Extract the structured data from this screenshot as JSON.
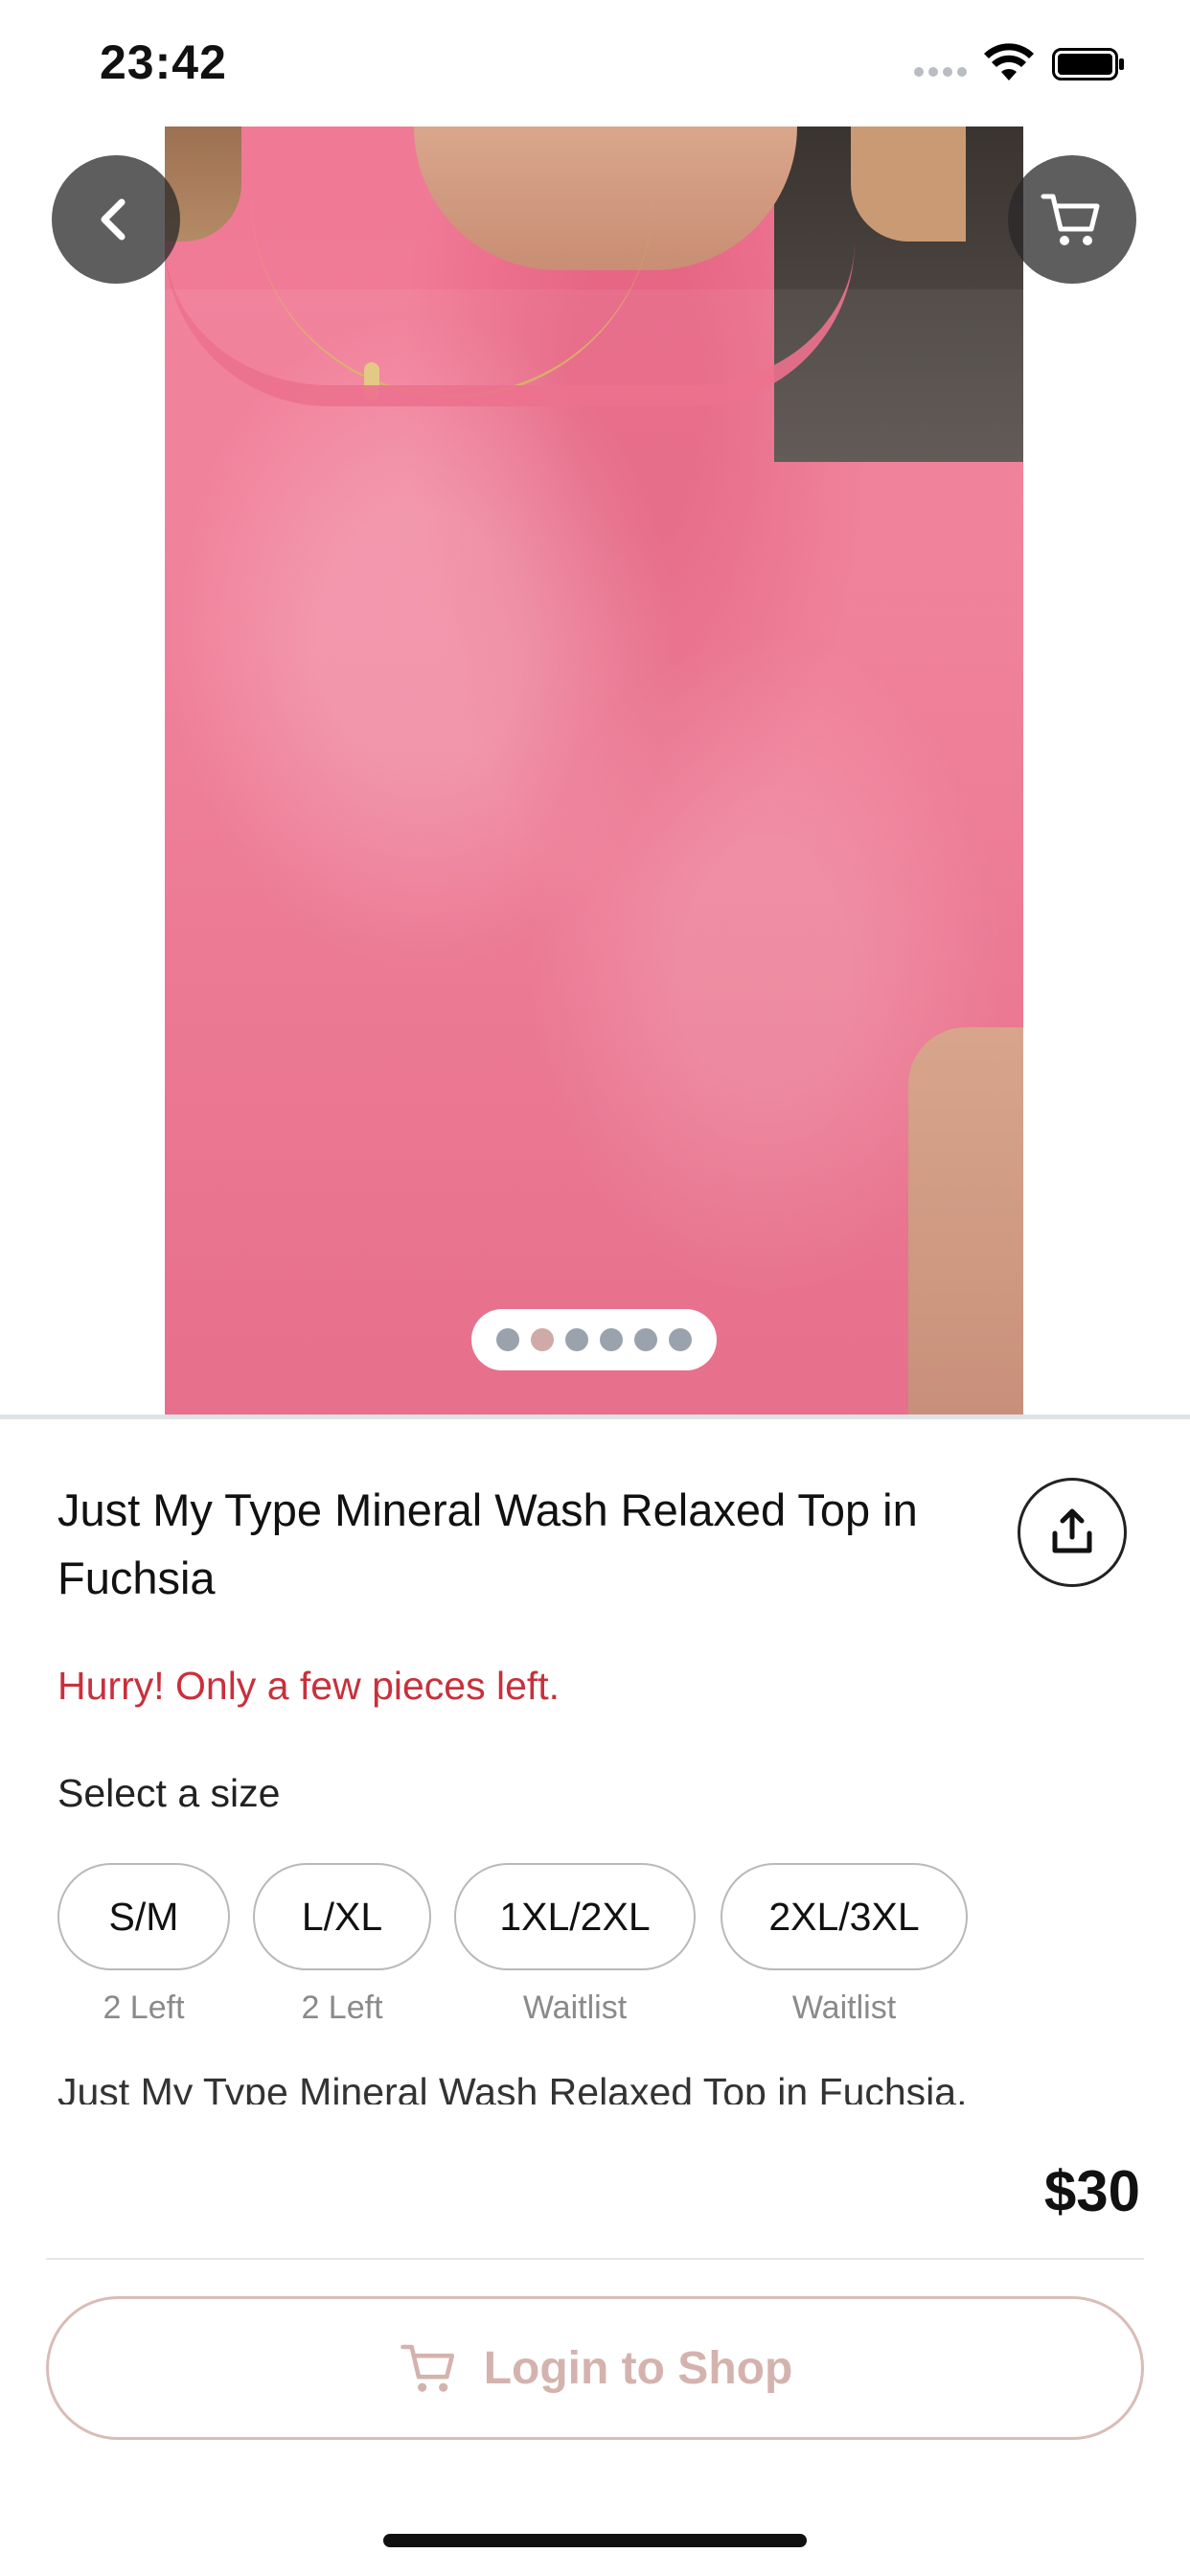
{
  "status_bar": {
    "time": "23:42"
  },
  "product": {
    "title": "Just My Type Mineral Wash Relaxed Top in Fuchsia",
    "stock_warning": "Hurry! Only a few pieces left.",
    "size_prompt": "Select a size",
    "sizes": [
      {
        "label": "S/M",
        "stock": "2 Left"
      },
      {
        "label": "L/XL",
        "stock": "2 Left"
      },
      {
        "label": "1XL/2XL",
        "stock": "Waitlist"
      },
      {
        "label": "2XL/3XL",
        "stock": "Waitlist"
      }
    ],
    "description_preview": "Just My Type Mineral Wash Relaxed Top in Fuchsia.",
    "price": "$30"
  },
  "gallery": {
    "image_count": 6,
    "active_index": 1
  },
  "actions": {
    "login_label": "Login to Shop"
  },
  "icons": {
    "back": "chevron-left-icon",
    "cart": "cart-icon",
    "share": "share-icon",
    "login_cart": "cart-icon"
  },
  "colors": {
    "warning": "#c8303c",
    "login_button_text": "#d4b3ae",
    "login_button_border": "#d9bcb8",
    "active_dot": "#cfaaa6",
    "inactive_dot": "#9aa3ad",
    "size_border": "#b9b9b9"
  }
}
